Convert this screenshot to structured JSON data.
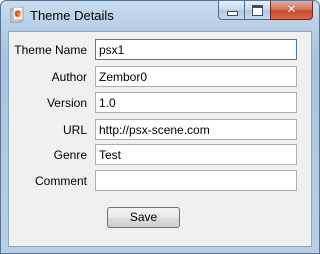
{
  "window": {
    "title": "Theme Details",
    "controls": {
      "minimize": "minimize",
      "maximize": "maximize",
      "close": "✕"
    }
  },
  "form": {
    "fields": [
      {
        "label": "Theme Name",
        "value": "psx1"
      },
      {
        "label": "Author",
        "value": "Zembor0"
      },
      {
        "label": "Version",
        "value": "1.0"
      },
      {
        "label": "URL",
        "value": "http://psx-scene.com"
      },
      {
        "label": "Genre",
        "value": "Test"
      },
      {
        "label": "Comment",
        "value": ""
      }
    ],
    "save_label": "Save"
  },
  "colors": {
    "titlebar": "#b6cde6",
    "client_bg": "#f0f0f0",
    "focus_border": "#3c7fb1",
    "close_button": "#c74a2b"
  },
  "icons": {
    "app": "theme-app-icon"
  }
}
